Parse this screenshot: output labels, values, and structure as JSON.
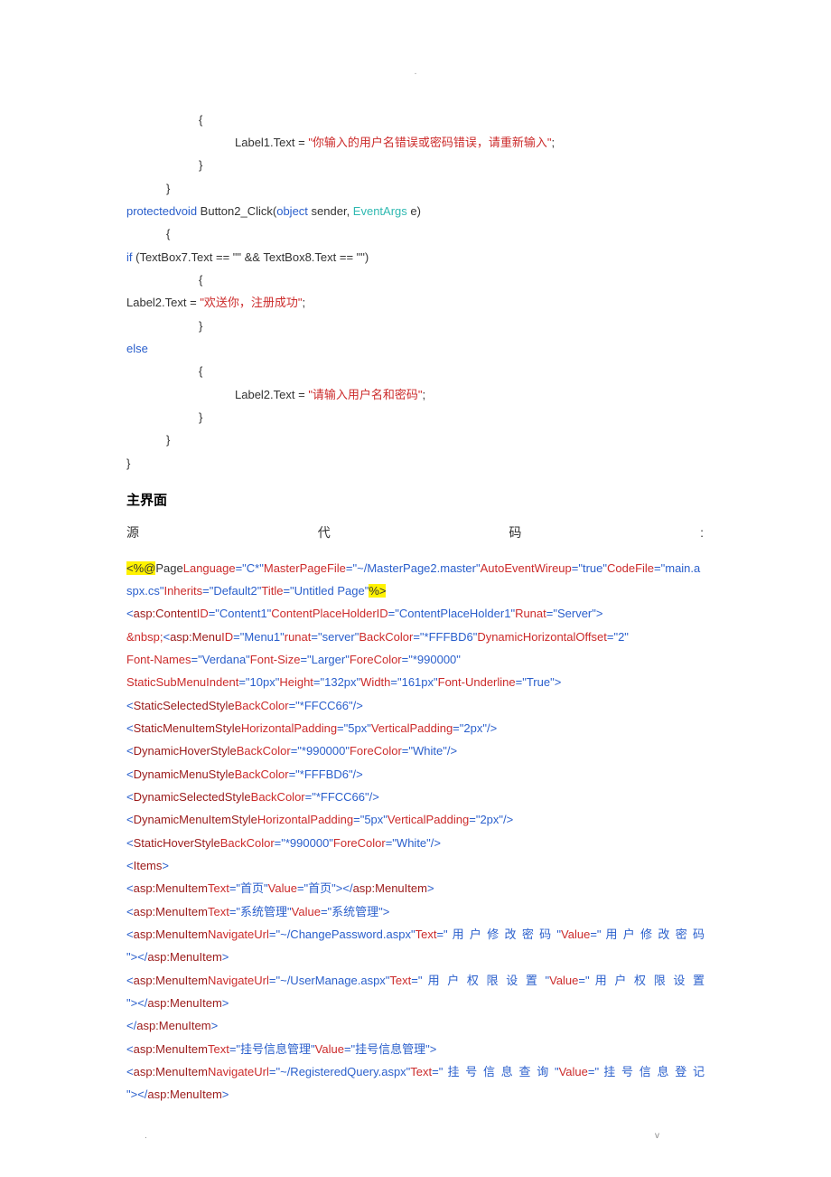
{
  "topMark": ".",
  "cs": {
    "l1": "{",
    "l2a": "Label1.Text = ",
    "l2b": "\"你输入的用户名错误或密码错误，请重新输入\"",
    "l2c": ";",
    "l3": "}",
    "l4": "}",
    "l5a": "protectedvoid",
    "l5b": " Button2_Click(",
    "l5c": "object",
    "l5d": " sender, ",
    "l5e": "EventArgs",
    "l5f": " e)",
    "l6": "{",
    "l7a": "if",
    "l7b": " (TextBox7.Text == \"\" && TextBox8.Text == \"\")",
    "l8": "{",
    "l9a": "Label2.Text = ",
    "l9b": "\"欢送你，注册成功\"",
    "l9c": ";",
    "l10": "}",
    "l11": "else",
    "l12": "{",
    "l13a": "Label2.Text = ",
    "l13b": "\"请输入用户名和密码\"",
    "l13c": ";",
    "l14": "}",
    "l15": "}",
    "l16": "}"
  },
  "heading": "主界面",
  "src": {
    "a": "源",
    "b": "代",
    "c": "码",
    "d": ":"
  },
  "asp": {
    "p1a": "<%@",
    "p1b": "Page",
    "p1c": "Language",
    "p1d": "=\"C*\"",
    "p1e": "MasterPageFile",
    "p1f": "=\"~/MasterPage2.master\"",
    "p1g": "AutoEventWireup",
    "p1h": "=\"true\"",
    "p1i": "CodeFile",
    "p1j": "=\"main.a",
    "p2a": "spx.cs\"",
    "p2b": "Inherits",
    "p2c": "=\"Default2\"",
    "p2d": "Title",
    "p2e": "=\"Untitled Page\"",
    "p2f": "%>",
    "l3": "<asp:ContentID=\"Content1\"ContentPlaceHolderID=\"ContentPlaceHolder1\"Runat=\"Server\">",
    "l4": "&nbsp;<asp:MenuID=\"Menu1\"runat=\"server\"BackColor=\"*FFFBD6\"DynamicHorizontalOffset=\"2\"",
    "l5": "Font-Names=\"Verdana\"Font-Size=\"Larger\"ForeColor=\"*990000\"",
    "l6": "StaticSubMenuIndent=\"10px\"Height=\"132px\"Width=\"161px\"Font-Underline=\"True\">",
    "l7": "<StaticSelectedStyleBackColor=\"*FFCC66\"/>",
    "l8": "<StaticMenuItemStyleHorizontalPadding=\"5px\"VerticalPadding=\"2px\"/>",
    "l9": "<DynamicHoverStyleBackColor=\"*990000\"ForeColor=\"White\"/>",
    "l10": "<DynamicMenuStyleBackColor=\"*FFFBD6\"/>",
    "l11": "<DynamicSelectedStyleBackColor=\"*FFCC66\"/>",
    "l12": "<DynamicMenuItemStyleHorizontalPadding=\"5px\"VerticalPadding=\"2px\"/>",
    "l13": "<StaticHoverStyleBackColor=\"*990000\"ForeColor=\"White\"/>",
    "l14": "<Items>",
    "l15": "<asp:MenuItemText=\"首页\"Value=\"首页\"></asp:MenuItem>",
    "l16": "<asp:MenuItemText=\"系统管理\"Value=\"系统管理\">",
    "l17a": "<asp:MenuItemNavigateUrl=\"~/ChangePassword.aspx\"Text=\" 用 户 修 改 密 码 \"Value=\" 用 户 修 改 密 码",
    "l18": "\"></asp:MenuItem>",
    "l19a": "<asp:MenuItemNavigateUrl=\"~/UserManage.aspx\"Text=\" 用 户 权 限 设 置 \"Value=\" 用 户 权 限 设 置",
    "l20": "\"></asp:MenuItem>",
    "l21": "</asp:MenuItem>",
    "l22": "<asp:MenuItemText=\"挂号信息管理\"Value=\"挂号信息管理\">",
    "l23a": "<asp:MenuItemNavigateUrl=\"~/RegisteredQuery.aspx\"Text=\" 挂 号 信 息 查 询 \"Value=\" 挂 号 信 息 登 记",
    "l24": "\"></asp:MenuItem>"
  },
  "footer": {
    "left": ".",
    "right": "v"
  }
}
